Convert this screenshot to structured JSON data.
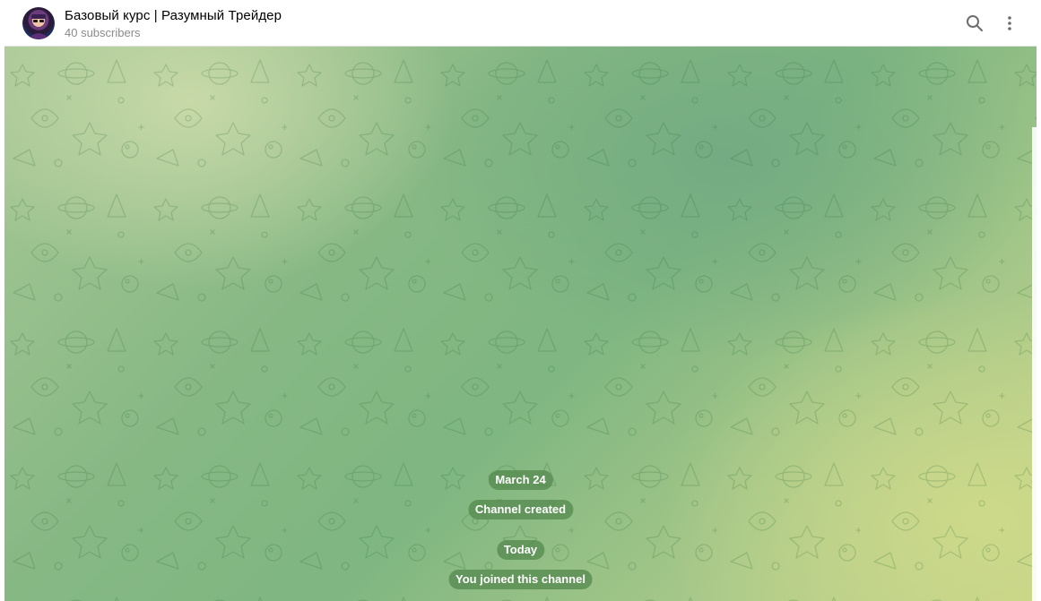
{
  "header": {
    "title": "Базовый курс | Разумный Трейдер",
    "subtitle": "40 subscribers",
    "search_icon": "search-icon",
    "more_icon": "more-vertical-icon"
  },
  "chat": {
    "service_messages": [
      "March 24",
      "Channel created",
      "Today",
      "You joined this channel"
    ]
  },
  "colors": {
    "service_bubble": "#568b50",
    "header_bg": "#ffffff",
    "subtitle": "#8a8a8a"
  }
}
